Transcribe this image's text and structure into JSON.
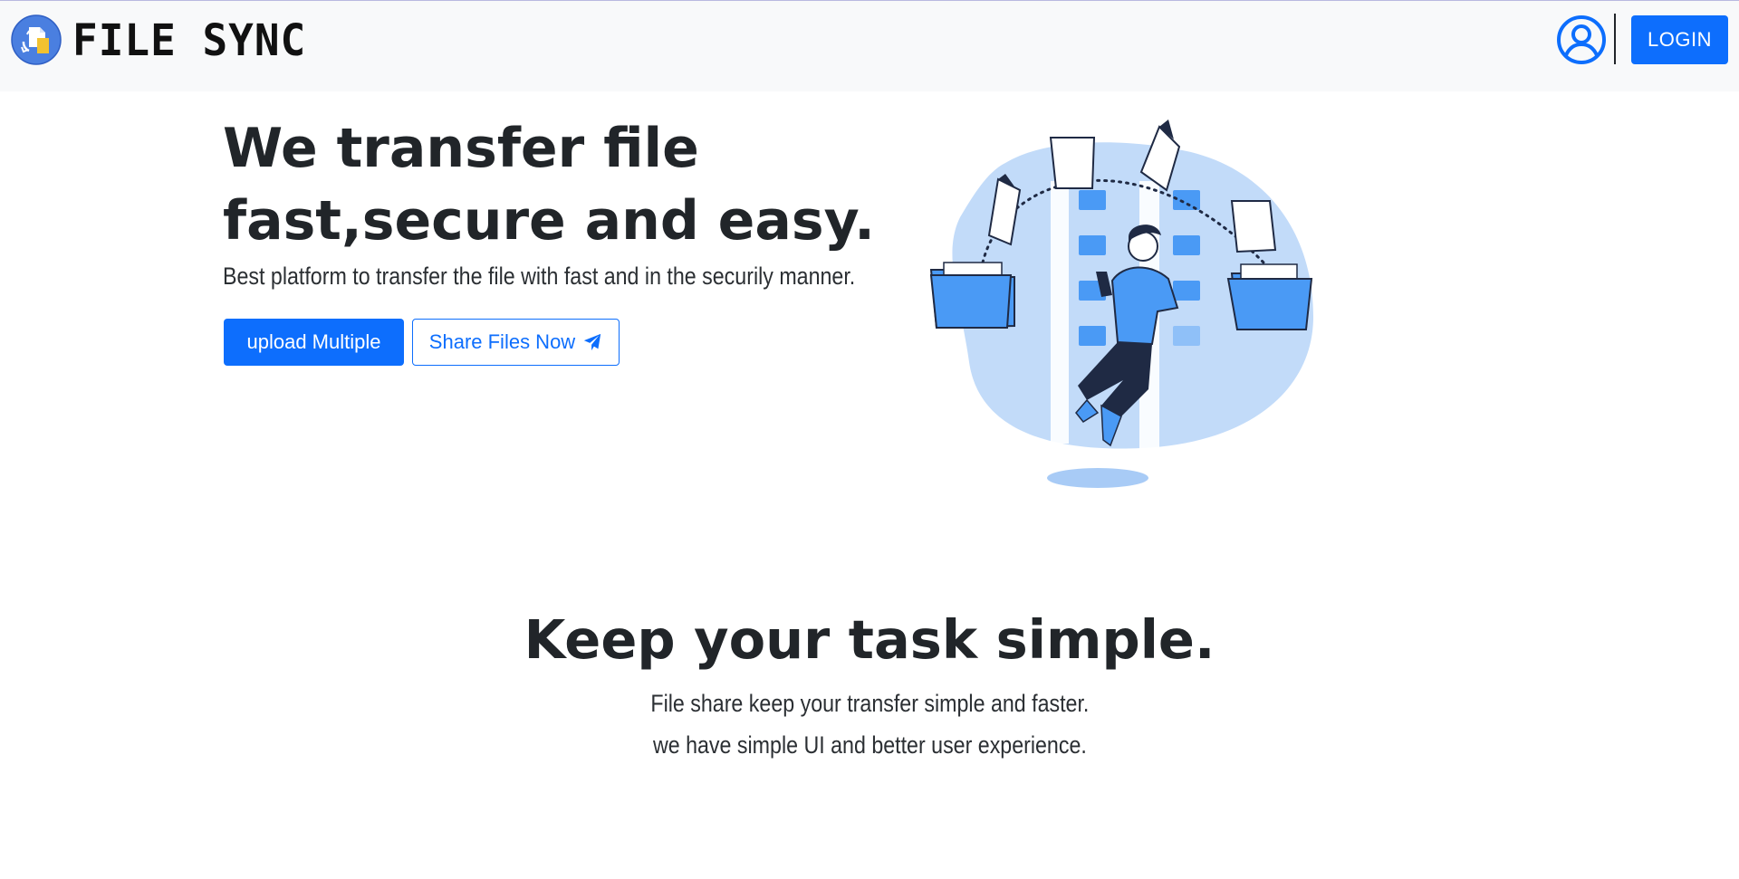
{
  "navbar": {
    "brand_name": "FILE SYNC",
    "logo_icon": "file-sync-logo-icon",
    "user_icon": "user-circle-icon",
    "login_label": "LOGIN"
  },
  "hero": {
    "title_line1": "We transfer file",
    "title_line2": "fast,secure and easy.",
    "subtitle": "Best platform to transfer the file with fast and in the securily manner.",
    "upload_button": "upload Multiple",
    "share_button": "Share Files Now",
    "share_icon": "paper-plane-icon",
    "illustration": "file-transfer-illustration"
  },
  "feature": {
    "title": "Keep your task simple.",
    "line1": "File share keep your transfer simple and faster.",
    "line2": "we have simple UI and better user experience."
  },
  "colors": {
    "primary": "#0d6efd",
    "navbar_bg": "#f8f9fa",
    "text": "#212529",
    "illustration_light": "#c2dbf9",
    "illustration_blue": "#4a9af5"
  }
}
